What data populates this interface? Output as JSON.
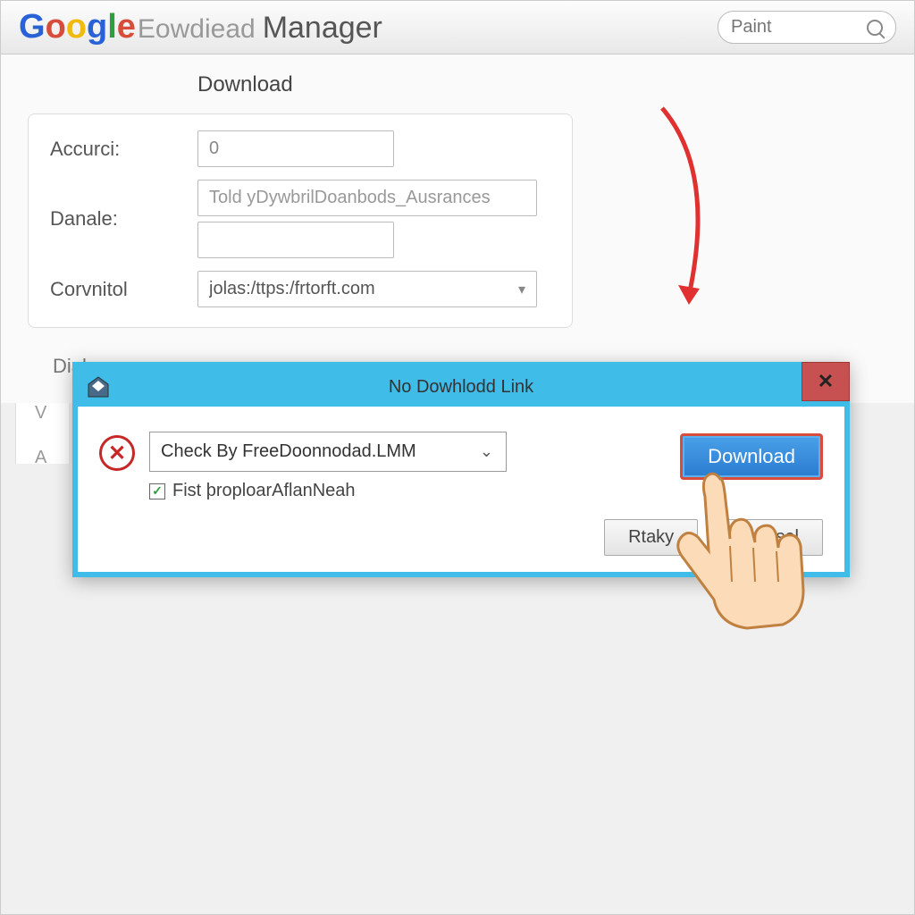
{
  "header": {
    "logo_sub": "Eowdiead",
    "logo_manager": "Manager",
    "search_placeholder": "Paint"
  },
  "form": {
    "section_title": "Download",
    "label_accurci": "Accurci:",
    "value_accurci": "0",
    "label_danale": "Danale:",
    "value_danale": "Told yDywbrilDoanbods_Ausrances",
    "label_corvnitol": "Corvnitol",
    "value_corvnitol": "jolas:/ttps:/frtorft.com"
  },
  "bg": {
    "group_label": "Diak",
    "l1": "V",
    "l2": "A"
  },
  "dialog": {
    "title": "No Dowhlodd Link",
    "combo_value": "Check By FreeDoonnodad.LMM",
    "checkbox_label": "Fist þroploarAflanNeah",
    "download_btn": "Download",
    "retry_btn": "Rtaky",
    "cancel_btn": "ansel"
  }
}
